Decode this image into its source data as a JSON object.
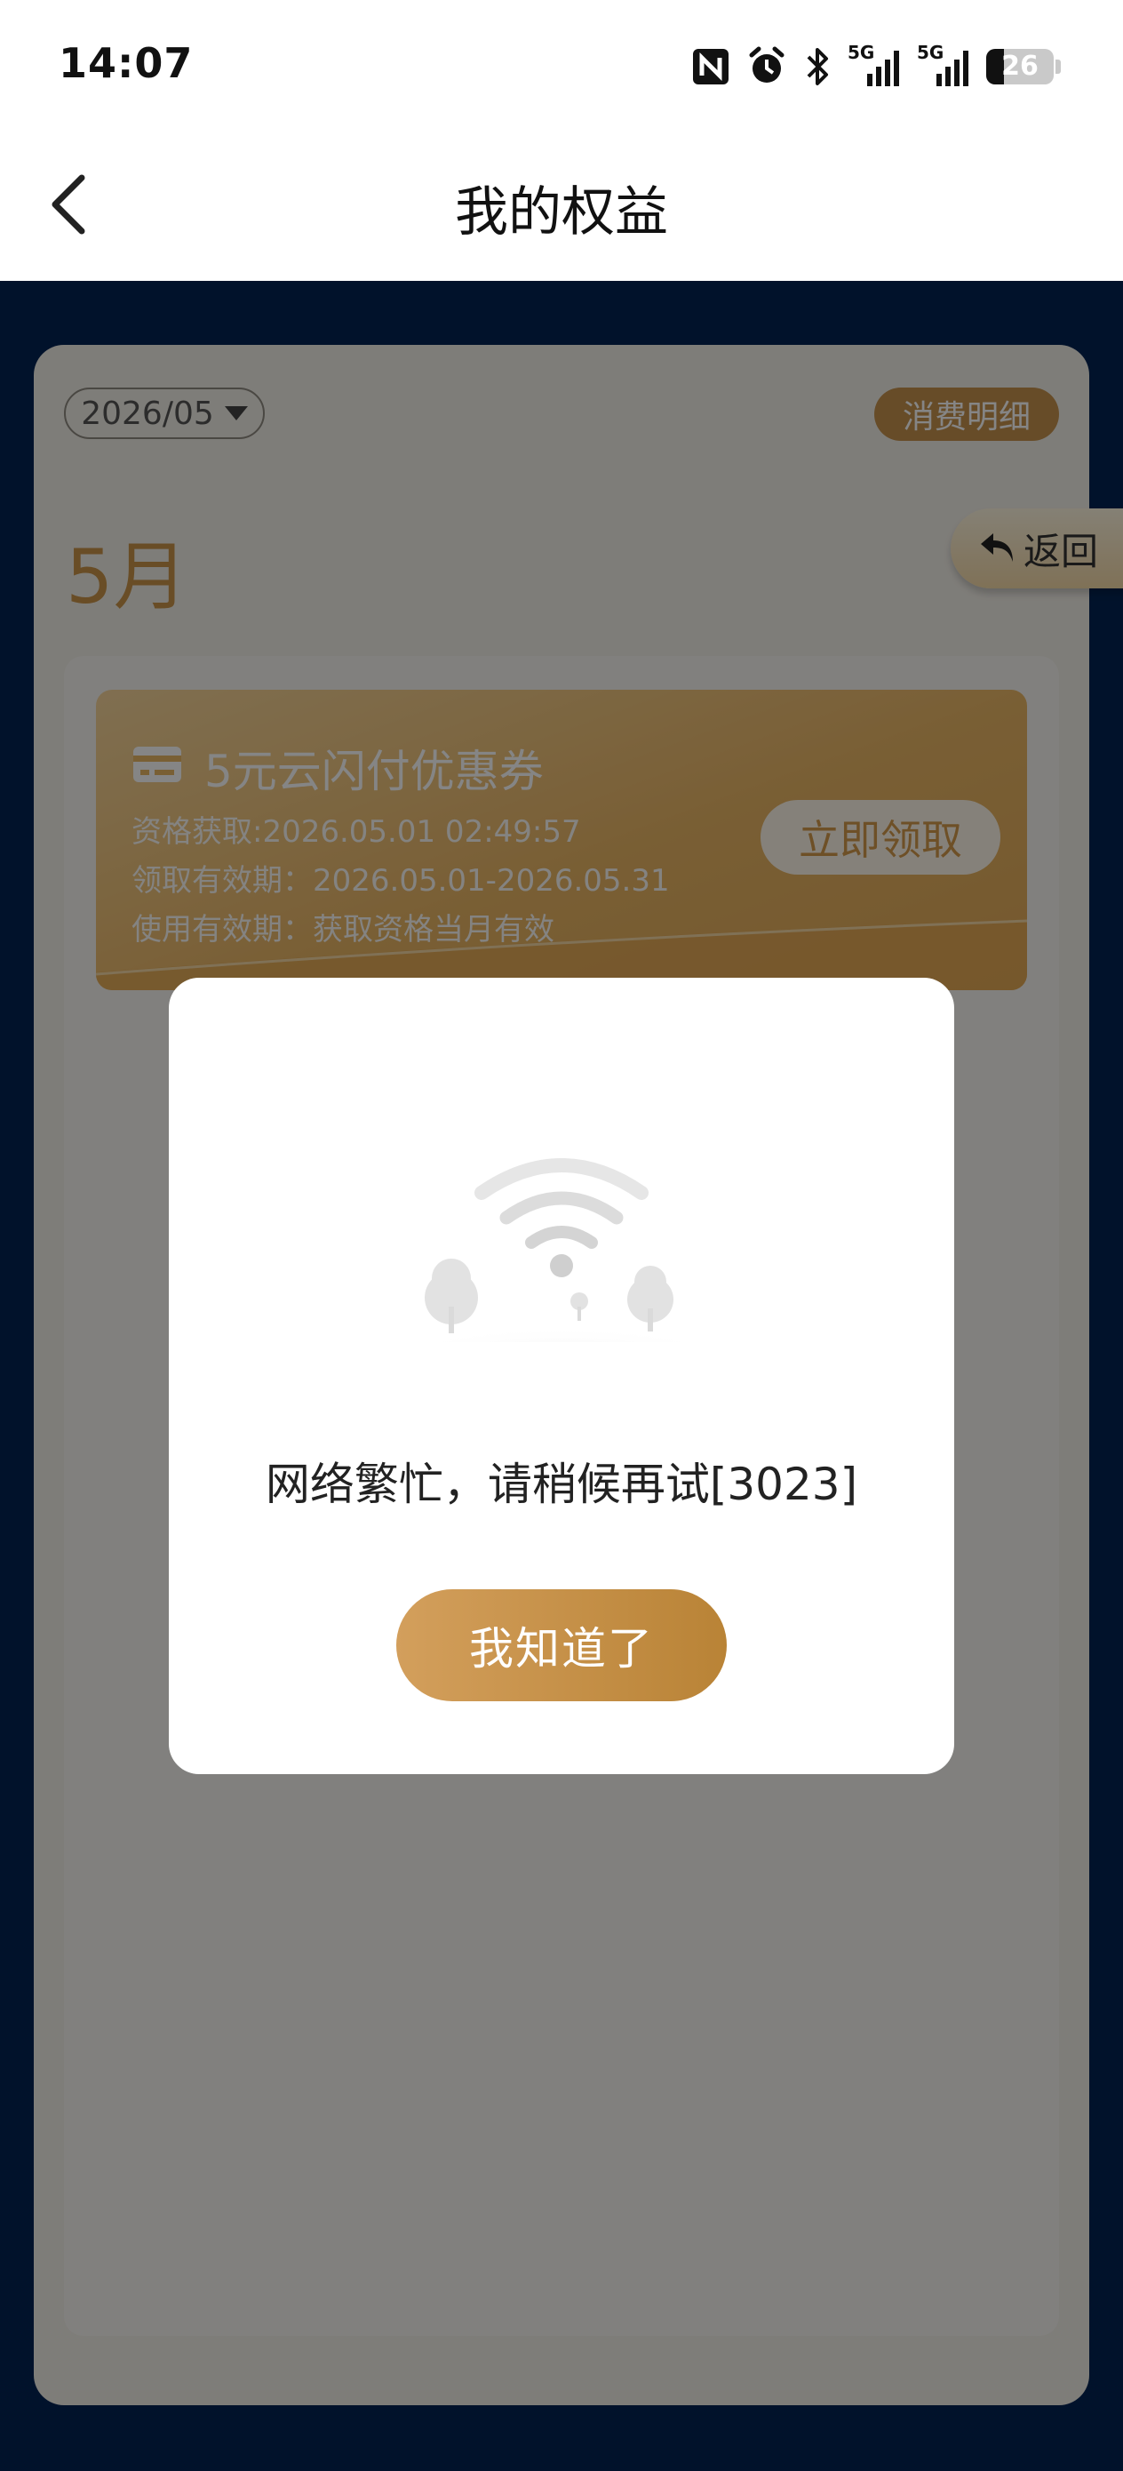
{
  "status_bar": {
    "time": "14:07",
    "icons": [
      "nfc-icon",
      "alarm-icon",
      "bluetooth-icon",
      "signal-5g-icon",
      "signal-5g-icon"
    ],
    "signal_label_1": "5G",
    "signal_label_2": "5G",
    "battery_level": "26"
  },
  "header": {
    "title": "我的权益",
    "back_icon": "chevron-left-icon"
  },
  "content": {
    "date_filter": "2026/05",
    "detail_button": "消费明细",
    "return_button": "返回",
    "month_label": "5月",
    "coupon": {
      "title": "5元云闪付优惠券",
      "qualification_time": "资格获取:2026.05.01 02:49:57",
      "claim_period": "领取有效期：2026.05.01-2026.05.31",
      "use_period": "使用有效期：获取资格当月有效",
      "claim_button": "立即领取"
    }
  },
  "dialog": {
    "illustration": "no-network-wifi-icon",
    "message": "网络繁忙，请稍候再试[3023]",
    "button": "我知道了"
  },
  "colors": {
    "brand_gold": "#c6934e",
    "page_blue": "#032453"
  }
}
